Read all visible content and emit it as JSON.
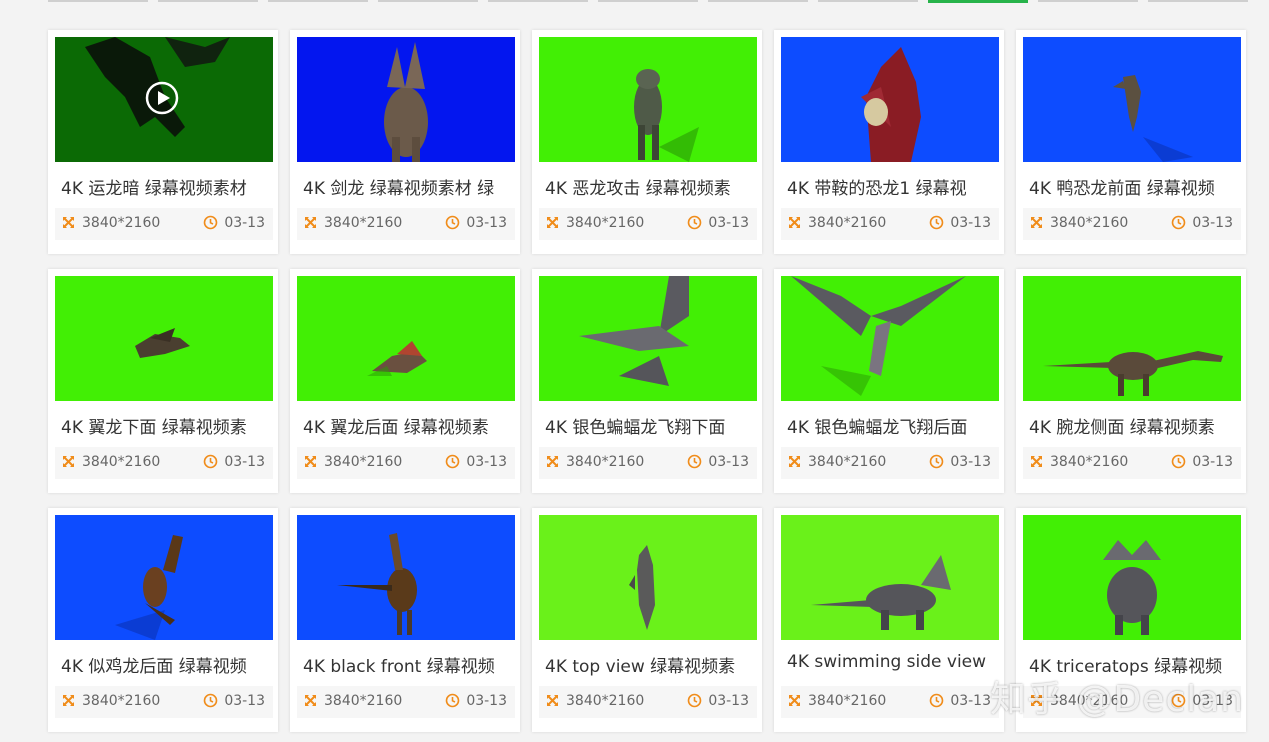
{
  "watermark": "知乎 @Declan",
  "colors": {
    "accent_orange": "#f08c1a",
    "dark_green": "#0b6a05",
    "green_screen": "#42ef05",
    "blue_screen": "#0d4cff",
    "deep_blue": "#0316ef"
  },
  "videos": [
    {
      "title": "4K 运龙暗 绿幕视频素材",
      "resolution": "3840*2160",
      "date": "03-13",
      "bg": "#0b6a05",
      "subject": "dragon",
      "has_play": true
    },
    {
      "title": "4K 剑龙 绿幕视频素材 绿",
      "resolution": "3840*2160",
      "date": "03-13",
      "bg": "#0316ef",
      "subject": "stegosaurus-front",
      "has_play": false
    },
    {
      "title": "4K 恶龙攻击 绿幕视频素",
      "resolution": "3840*2160",
      "date": "03-13",
      "bg": "#42ef05",
      "subject": "trex-front",
      "has_play": false
    },
    {
      "title": "4K 带鞍的恐龙1 绿幕视",
      "resolution": "3840*2160",
      "date": "03-13",
      "bg": "#0d4cff",
      "subject": "red-dino",
      "has_play": false
    },
    {
      "title": "4K 鸭恐龙前面 绿幕视频",
      "resolution": "3840*2160",
      "date": "03-13",
      "bg": "#0d4cff",
      "subject": "raptor-small",
      "has_play": false
    },
    {
      "title": "4K 翼龙下面 绿幕视频素",
      "resolution": "3840*2160",
      "date": "03-13",
      "bg": "#42ef05",
      "subject": "pterosaur-small",
      "has_play": false
    },
    {
      "title": "4K 翼龙后面 绿幕视频素",
      "resolution": "3840*2160",
      "date": "03-13",
      "bg": "#42ef05",
      "subject": "pterosaur-back",
      "has_play": false
    },
    {
      "title": "4K 银色蝙蝠龙飞翔下面",
      "resolution": "3840*2160",
      "date": "03-13",
      "bg": "#42ef05",
      "subject": "bat-dragon",
      "has_play": false
    },
    {
      "title": "4K 银色蝙蝠龙飞翔后面",
      "resolution": "3840*2160",
      "date": "03-13",
      "bg": "#42ef05",
      "subject": "bat-dragon-back",
      "has_play": false
    },
    {
      "title": "4K 腕龙侧面 绿幕视频素",
      "resolution": "3840*2160",
      "date": "03-13",
      "bg": "#42ef05",
      "subject": "brachiosaurus",
      "has_play": false
    },
    {
      "title": "4K 似鸡龙后面 绿幕视频",
      "resolution": "3840*2160",
      "date": "03-13",
      "bg": "#0d4cff",
      "subject": "ornithomimus-back",
      "has_play": false
    },
    {
      "title": "4K black front 绿幕视频",
      "resolution": "3840*2160",
      "date": "03-13",
      "bg": "#0d4cff",
      "subject": "ornithomimus-front",
      "has_play": false
    },
    {
      "title": "4K top view 绿幕视频素",
      "resolution": "3840*2160",
      "date": "03-13",
      "bg": "#6af11a",
      "subject": "top-view",
      "has_play": false
    },
    {
      "title": "4K swimming side view",
      "resolution": "3840*2160",
      "date": "03-13",
      "bg": "#6af11a",
      "subject": "triceratops-side",
      "has_play": false
    },
    {
      "title": "4K triceratops 绿幕视频",
      "resolution": "3840*2160",
      "date": "03-13",
      "bg": "#42ef05",
      "subject": "triceratops-front",
      "has_play": false
    }
  ]
}
